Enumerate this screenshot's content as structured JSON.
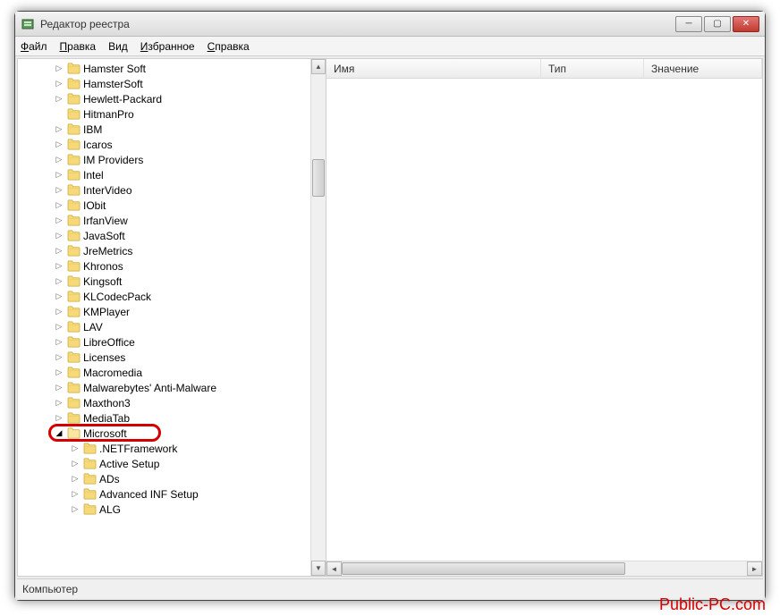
{
  "window": {
    "title": "Редактор реестра"
  },
  "menu": {
    "file": "Файл",
    "edit": "Правка",
    "view": "Вид",
    "favorites": "Избранное",
    "help": "Справка"
  },
  "columns": {
    "name": "Имя",
    "type": "Тип",
    "value": "Значение"
  },
  "tree": {
    "items": [
      {
        "label": "Hamster Soft",
        "depth": 5,
        "exp": "closed"
      },
      {
        "label": "HamsterSoft",
        "depth": 5,
        "exp": "closed"
      },
      {
        "label": "Hewlett-Packard",
        "depth": 5,
        "exp": "closed"
      },
      {
        "label": "HitmanPro",
        "depth": 5,
        "exp": "none"
      },
      {
        "label": "IBM",
        "depth": 5,
        "exp": "closed"
      },
      {
        "label": "Icaros",
        "depth": 5,
        "exp": "closed"
      },
      {
        "label": "IM Providers",
        "depth": 5,
        "exp": "closed"
      },
      {
        "label": "Intel",
        "depth": 5,
        "exp": "closed"
      },
      {
        "label": "InterVideo",
        "depth": 5,
        "exp": "closed"
      },
      {
        "label": "IObit",
        "depth": 5,
        "exp": "closed"
      },
      {
        "label": "IrfanView",
        "depth": 5,
        "exp": "closed"
      },
      {
        "label": "JavaSoft",
        "depth": 5,
        "exp": "closed"
      },
      {
        "label": "JreMetrics",
        "depth": 5,
        "exp": "closed"
      },
      {
        "label": "Khronos",
        "depth": 5,
        "exp": "closed"
      },
      {
        "label": "Kingsoft",
        "depth": 5,
        "exp": "closed"
      },
      {
        "label": "KLCodecPack",
        "depth": 5,
        "exp": "closed"
      },
      {
        "label": "KMPlayer",
        "depth": 5,
        "exp": "closed"
      },
      {
        "label": "LAV",
        "depth": 5,
        "exp": "closed"
      },
      {
        "label": "LibreOffice",
        "depth": 5,
        "exp": "closed"
      },
      {
        "label": "Licenses",
        "depth": 5,
        "exp": "closed"
      },
      {
        "label": "Macromedia",
        "depth": 5,
        "exp": "closed"
      },
      {
        "label": "Malwarebytes' Anti-Malware",
        "depth": 5,
        "exp": "closed"
      },
      {
        "label": "Maxthon3",
        "depth": 5,
        "exp": "closed"
      },
      {
        "label": "MediaTab",
        "depth": 5,
        "exp": "closed"
      },
      {
        "label": "Microsoft",
        "depth": 5,
        "exp": "open",
        "highlight": true
      },
      {
        "label": ".NETFramework",
        "depth": 6,
        "exp": "closed"
      },
      {
        "label": "Active Setup",
        "depth": 6,
        "exp": "closed"
      },
      {
        "label": "ADs",
        "depth": 6,
        "exp": "closed"
      },
      {
        "label": "Advanced INF Setup",
        "depth": 6,
        "exp": "closed"
      },
      {
        "label": "ALG",
        "depth": 6,
        "exp": "closed"
      }
    ]
  },
  "status": {
    "path": "Компьютер"
  },
  "watermark": "Public-PC.com"
}
